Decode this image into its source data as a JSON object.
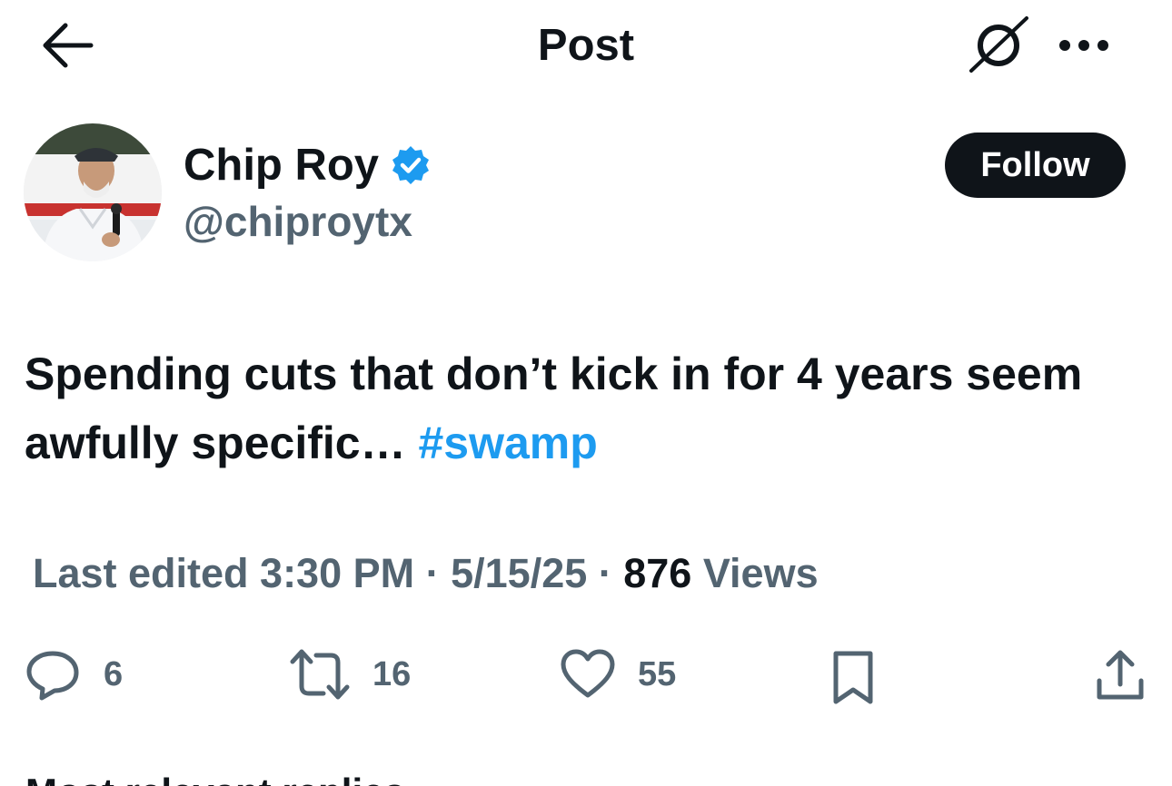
{
  "header": {
    "title": "Post"
  },
  "icons": {
    "back": "arrow-left-icon",
    "grok": "grok-icon",
    "more": "more-horizontal-icon",
    "verified": "verified-badge-icon",
    "reply": "reply-icon",
    "retweet": "retweet-icon",
    "like": "heart-icon",
    "bookmark": "bookmark-icon",
    "share": "share-icon"
  },
  "author": {
    "name": "Chip Roy",
    "handle": "@chiproytx",
    "follow_label": "Follow"
  },
  "tweet": {
    "text": "Spending cuts that don’t kick in for 4 years seem awfully specific… ",
    "hashtag": "#swamp"
  },
  "meta": {
    "edited_label": "Last edited 3:30 PM · 5/15/25",
    "separator": " · ",
    "views_count": "876",
    "views_label": " Views"
  },
  "actions": {
    "replies": "6",
    "retweets": "16",
    "likes": "55"
  },
  "cutoff_text": "Most relevant replies",
  "colors": {
    "accent": "#1d9bf0",
    "text": "#0f1419",
    "muted": "#536471",
    "follow_bg": "#0f1419"
  }
}
